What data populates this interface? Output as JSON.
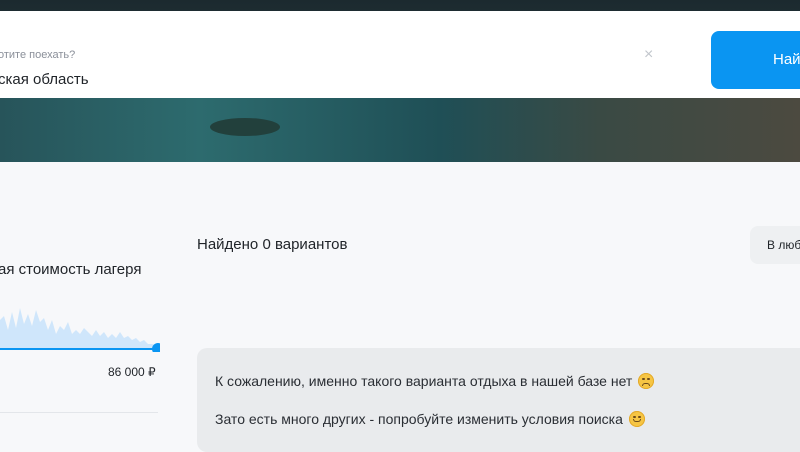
{
  "search": {
    "label": "отите поехать?",
    "value": "ская область",
    "clear_icon": "×",
    "button_label": "Най"
  },
  "filters": {
    "price_title": "ая стоимость лагеря",
    "price_max_label": "86 000 ₽"
  },
  "results": {
    "found_text": "Найдено 0 вариантов",
    "sort_label": "В люб"
  },
  "message": {
    "line1": "К сожалению, именно такого варианта отдыха в нашей базе нет",
    "line1_emoji": "sad-face-icon",
    "line2": "Зато есть много других - попробуйте изменить условия поиска",
    "line2_emoji": "smiling-face-icon"
  },
  "colors": {
    "accent": "#0a95f2",
    "histogram": "#cfe6fb"
  }
}
